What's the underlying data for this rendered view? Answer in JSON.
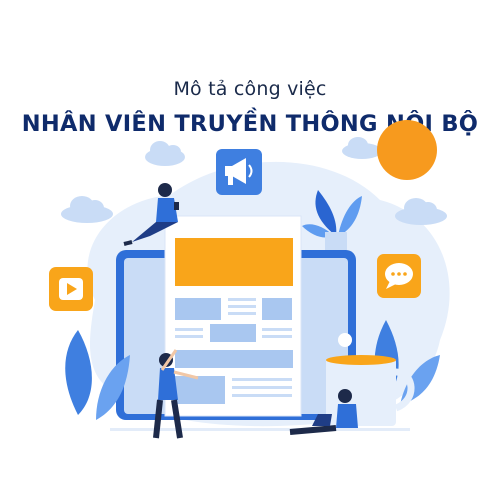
{
  "header": {
    "subtitle": "Mô tả công việc",
    "title": "NHÂN VIÊN TRUYỀN THÔNG NỘI BỘ"
  },
  "colors": {
    "title": "#0f2b6b",
    "primary_blue": "#2f6fd8",
    "dark_blue": "#1f4fb8",
    "light_blue": "#c9dcf6",
    "pale_blue": "#e6effb",
    "accent_orange": "#f9a51a",
    "sun": "#f79a1e"
  },
  "icons": [
    "megaphone-icon",
    "play-icon",
    "chat-bubble-icon",
    "sun-icon",
    "plant-icon",
    "coffee-mug-icon"
  ]
}
